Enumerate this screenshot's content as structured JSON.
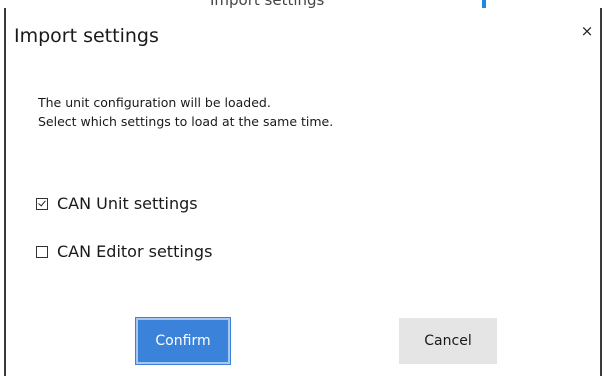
{
  "background": {
    "partial_text": "Import settings",
    "accent_color": "#1e88e5"
  },
  "dialog": {
    "title": "Import settings",
    "close_label": "×",
    "message_line1": "The unit configuration will be loaded.",
    "message_line2": "Select which settings to load at the same time.",
    "options": [
      {
        "label": "CAN Unit settings",
        "checked": true
      },
      {
        "label": "CAN Editor settings",
        "checked": false
      }
    ],
    "confirm_label": "Confirm",
    "cancel_label": "Cancel"
  },
  "colors": {
    "confirm_bg": "#3b82db",
    "cancel_bg": "#e5e5e5",
    "border": "#3a3a3a"
  }
}
